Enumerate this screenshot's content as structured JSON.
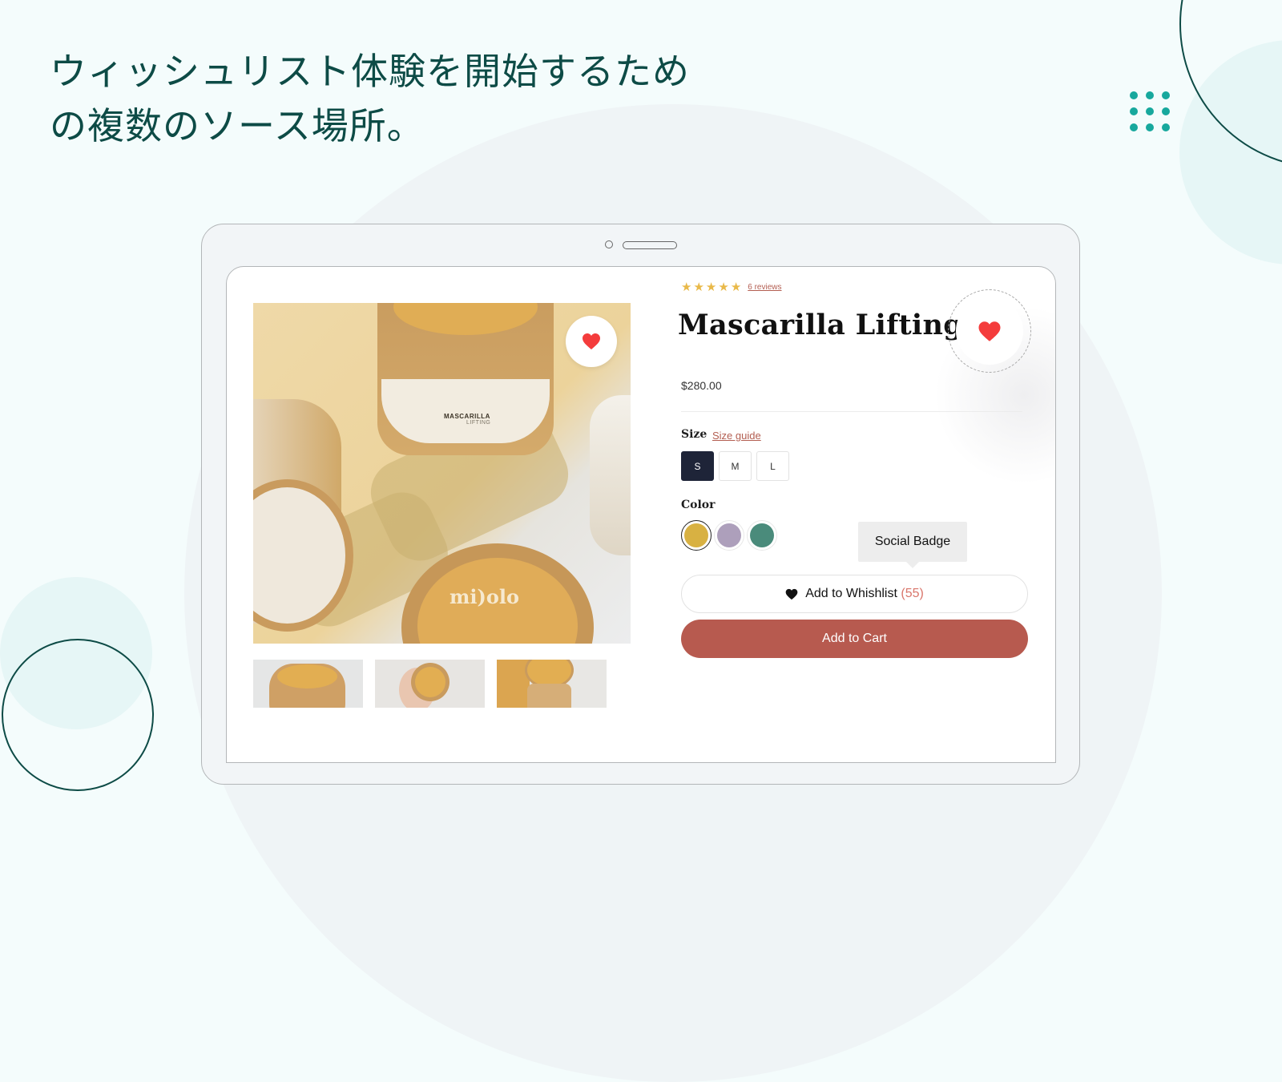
{
  "headline": {
    "line1": "ウィッシュリスト体験を開始するため",
    "line2": "の複数のソース場所。"
  },
  "product": {
    "title": "Mascarilla Lifting",
    "rating": {
      "stars": 5,
      "max": 5,
      "reviews_label": "6 reviews"
    },
    "price": "$280.00",
    "image": {
      "label_line1": "MASCARILLA",
      "label_line2": "LIFTING",
      "brand": "mi)olo",
      "thumbnail_count": 3
    },
    "size": {
      "label": "Size",
      "guide_link": "Size guide",
      "options": [
        "S",
        "M",
        "L"
      ],
      "selected": "S"
    },
    "color": {
      "label": "Color",
      "options": [
        {
          "name": "mustard",
          "hex": "#d8b142"
        },
        {
          "name": "lavender",
          "hex": "#ad9fbb"
        },
        {
          "name": "teal",
          "hex": "#4a8b7b"
        }
      ],
      "selected": "mustard"
    },
    "tooltip": "Social Badge",
    "wishlist_button": {
      "label": "Add to Whishlist",
      "count": "(55)",
      "icon": "heart-icon"
    },
    "cart_button": {
      "label": "Add to Cart"
    }
  },
  "colors": {
    "accent_teal": "#17a89d",
    "dark_green": "#0d4b46",
    "heart_red": "#f43c3c",
    "cart_brick": "#b75a4f",
    "star_gold": "#e9b949"
  }
}
